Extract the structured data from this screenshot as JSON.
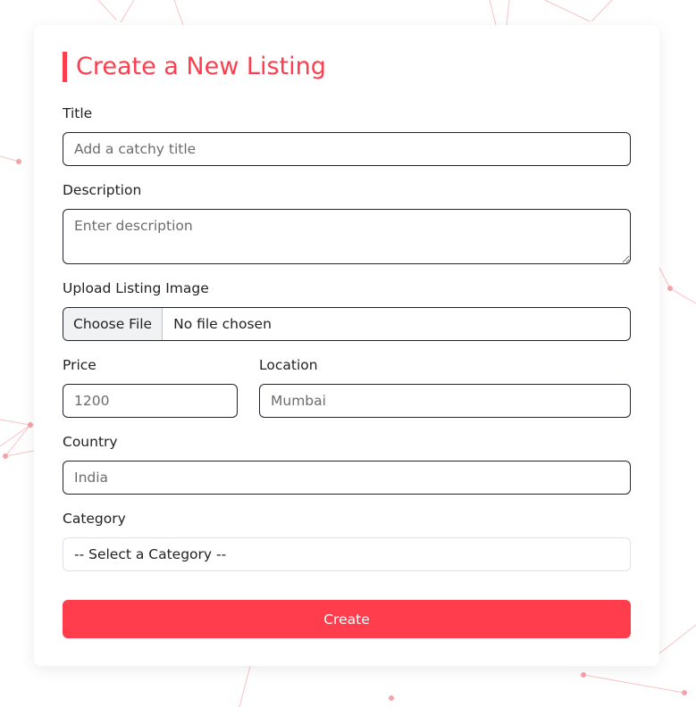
{
  "form": {
    "heading": "Create a New Listing",
    "title": {
      "label": "Title",
      "placeholder": "Add a catchy title"
    },
    "description": {
      "label": "Description",
      "placeholder": "Enter description"
    },
    "image": {
      "label": "Upload Listing Image",
      "button_label": "Choose File",
      "status": "No file chosen"
    },
    "price": {
      "label": "Price",
      "placeholder": "1200"
    },
    "location": {
      "label": "Location",
      "placeholder": "Mumbai"
    },
    "country": {
      "label": "Country",
      "placeholder": "India"
    },
    "category": {
      "label": "Category",
      "selected": "-- Select a Category --"
    },
    "submit_label": "Create"
  },
  "colors": {
    "accent": "#ff3d4c",
    "background_network": "#f5a3a8"
  }
}
